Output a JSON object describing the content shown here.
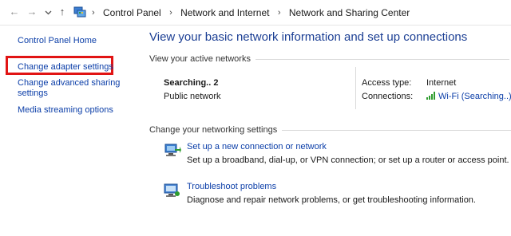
{
  "address_bar": {
    "back_icon": "arrow-left-icon",
    "forward_icon": "arrow-right-icon",
    "recent_icon": "chevron-down-icon",
    "up_icon": "arrow-up-icon",
    "breadcrumbs": [
      "Control Panel",
      "Network and Internet",
      "Network and Sharing Center"
    ]
  },
  "sidebar": {
    "home": "Control Panel Home",
    "links": [
      "Change adapter settings",
      "Change advanced sharing settings",
      "Media streaming options"
    ],
    "highlight_color": "#e11414"
  },
  "main": {
    "title": "View your basic network information and set up connections",
    "active_networks_heading": "View your active networks",
    "network": {
      "name": "Searching.. 2",
      "type": "Public network",
      "access_label": "Access type:",
      "access_value": "Internet",
      "connections_label": "Connections:",
      "connections_value": "Wi-Fi (Searching..)"
    },
    "settings_heading": "Change your networking settings",
    "tasks": [
      {
        "link": "Set up a new connection or network",
        "description": "Set up a broadband, dial-up, or VPN connection; or set up a router or access point.",
        "icon": "network-setup-icon"
      },
      {
        "link": "Troubleshoot problems",
        "description": "Diagnose and repair network problems, or get troubleshooting information.",
        "icon": "troubleshoot-icon"
      }
    ]
  },
  "colors": {
    "link": "#0b3ea8",
    "title": "#1c3f94",
    "wifi_bars": "#2e9c2e"
  }
}
